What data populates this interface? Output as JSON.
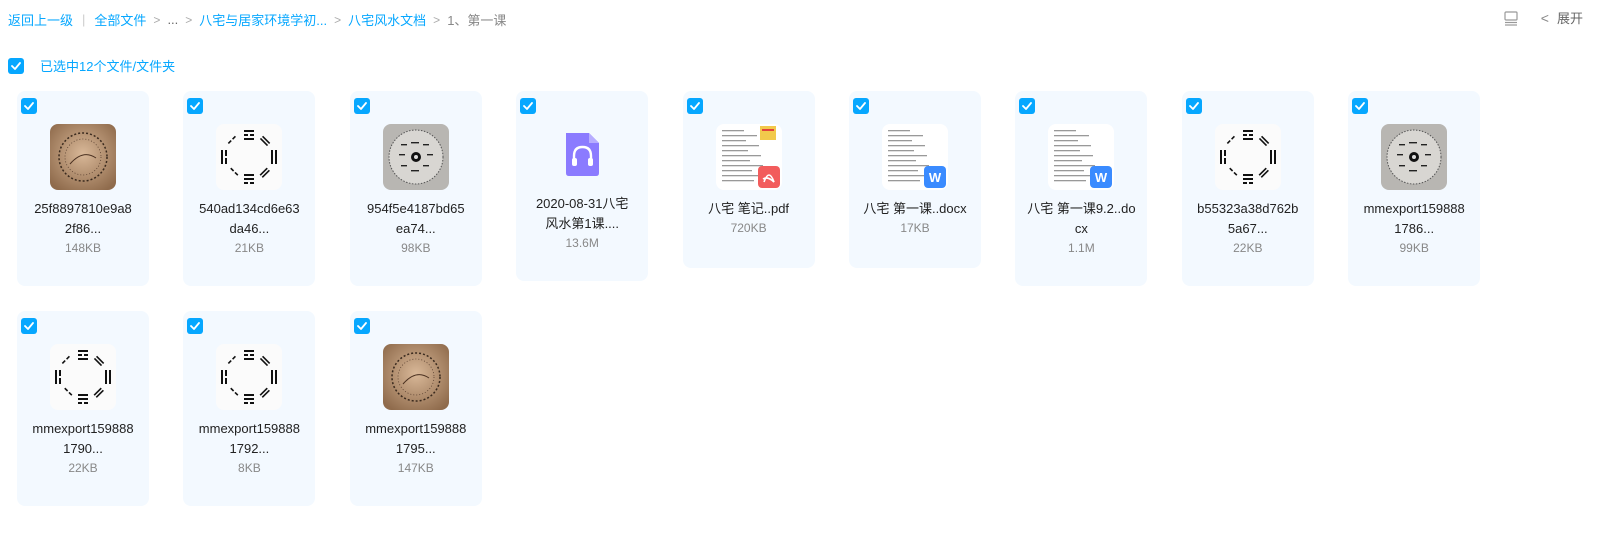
{
  "breadcrumb": {
    "back": "返回上一级",
    "all_files": "全部文件",
    "ellipsis": "...",
    "folder1": "八宅与居家环境学初...",
    "folder2": "八宅风水文档",
    "current": "1、第一课"
  },
  "toolbar": {
    "expand_label": "展开"
  },
  "selection": {
    "text": "已选中12个文件/文件夹"
  },
  "colors": {
    "accent": "#06a7ff",
    "card_bg": "#f3f9ff"
  },
  "files": [
    {
      "name_line1": "25f8897810e9a8",
      "name_line2": "2f86...",
      "size": "148KB",
      "kind": "photo-seal-brown"
    },
    {
      "name_line1": "540ad134cd6e63",
      "name_line2": "da46...",
      "size": "21KB",
      "kind": "bagua-white"
    },
    {
      "name_line1": "954f5e4187bd65",
      "name_line2": "ea74...",
      "size": "98KB",
      "kind": "photo-bagua-gray"
    },
    {
      "name_line1": "2020-08-31八宅",
      "name_line2": "风水第1课....",
      "size": "13.6M",
      "kind": "audio"
    },
    {
      "name_line1": "八宅 笔记..pdf",
      "name_line2": "",
      "size": "720KB",
      "kind": "pdf"
    },
    {
      "name_line1": "八宅 第一课..docx",
      "name_line2": "",
      "size": "17KB",
      "kind": "docx"
    },
    {
      "name_line1": "八宅 第一课9.2..do",
      "name_line2": "cx",
      "size": "1.1M",
      "kind": "docx"
    },
    {
      "name_line1": "b55323a38d762b",
      "name_line2": "5a67...",
      "size": "22KB",
      "kind": "bagua-white"
    },
    {
      "name_line1": "mmexport159888",
      "name_line2": "1786...",
      "size": "99KB",
      "kind": "photo-bagua-gray"
    },
    {
      "name_line1": "mmexport159888",
      "name_line2": "1790...",
      "size": "22KB",
      "kind": "bagua-white"
    },
    {
      "name_line1": "mmexport159888",
      "name_line2": "1792...",
      "size": "8KB",
      "kind": "bagua-white"
    },
    {
      "name_line1": "mmexport159888",
      "name_line2": "1795...",
      "size": "147KB",
      "kind": "photo-seal-brown"
    }
  ]
}
